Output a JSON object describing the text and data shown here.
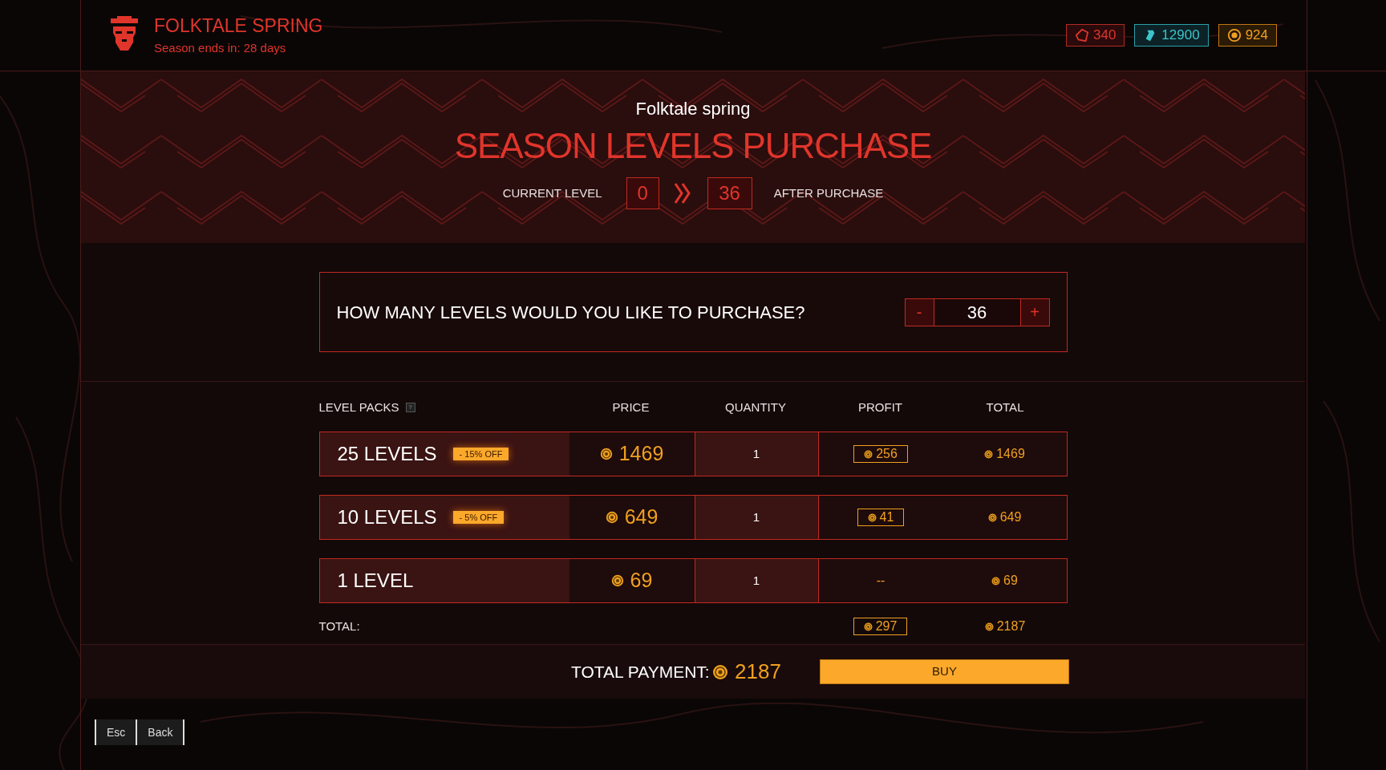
{
  "header": {
    "title": "FOLKTALE SPRING",
    "subtitle": "Season ends in: 28 days"
  },
  "currencies": [
    {
      "kind": "sc",
      "amount": "340"
    },
    {
      "kind": "ticket",
      "amount": "12900"
    },
    {
      "kind": "coin",
      "amount": "924"
    }
  ],
  "hero": {
    "season": "Folktale spring",
    "title": "SEASON LEVELS PURCHASE",
    "current_label": "CURRENT LEVEL",
    "current_level": "0",
    "after_level": "36",
    "after_label": "AFTER PURCHASE"
  },
  "question": {
    "text": "HOW MANY LEVELS WOULD YOU LIKE TO PURCHASE?",
    "minus": "-",
    "value": "36",
    "plus": "+"
  },
  "table": {
    "columns": [
      "LEVEL PACKS",
      "PRICE",
      "QUANTITY",
      "PROFIT",
      "TOTAL"
    ],
    "help": "?",
    "rows": [
      {
        "name": "25 LEVELS",
        "discount": "- 15% OFF",
        "price": "1469",
        "quantity": "1",
        "kind": "amount",
        "profit": "256",
        "total": "1469"
      },
      {
        "name": "10 LEVELS",
        "discount": "- 5% OFF",
        "price": "649",
        "quantity": "1",
        "kind": "amount",
        "profit": "41",
        "total": "649"
      },
      {
        "name": "1 LEVEL",
        "price": "69",
        "quantity": "1",
        "kind": "none",
        "profit": "--",
        "total": "69"
      }
    ],
    "total_label": "TOTAL:",
    "total_profit": "297",
    "total": "2187"
  },
  "footer": {
    "label": "TOTAL PAYMENT:",
    "amount": "2187",
    "buy": "BUY"
  },
  "nav": [
    {
      "key": "Esc"
    },
    {
      "key": "Back"
    }
  ]
}
